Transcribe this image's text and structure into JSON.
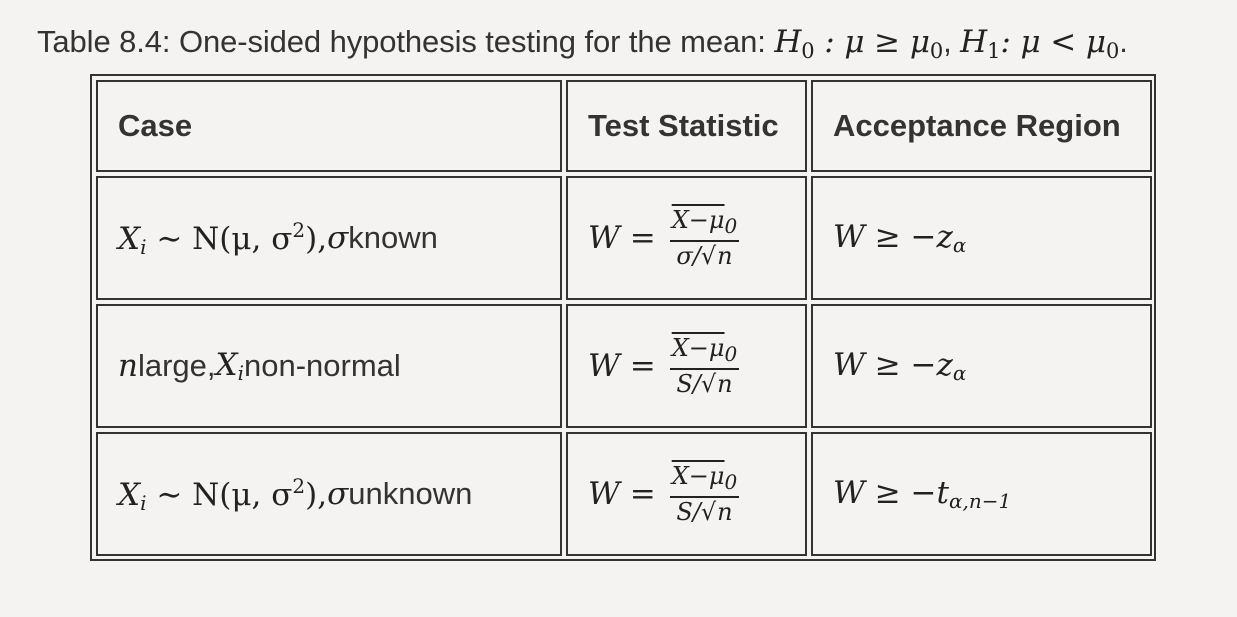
{
  "caption": {
    "prefix": "Table 8.4: One-sided hypothesis testing for the mean: ",
    "h0": "H",
    "h0_sub": "0",
    "h0_rest": " : μ ≥ μ",
    "h0_rest_sub": "0",
    "comma": ", ",
    "h1": "H",
    "h1_sub": "1",
    "h1_rest": ": μ < μ",
    "h1_rest_sub": "0",
    "period": "."
  },
  "table": {
    "headers": [
      "Case",
      "Test Statistic",
      "Acceptance Region"
    ],
    "rows": [
      {
        "case_math": "X",
        "case_math_sub": "i",
        "case_math_rest": " ∼ N(μ, σ",
        "case_math_sup": "2",
        "case_math_close": "),",
        "case_sigma": " σ",
        "case_text": " known",
        "stat_lhs": "W =",
        "stat_num": "X−μ",
        "stat_num_sub": "0",
        "stat_den_pre": "σ/",
        "stat_den_sqrt": "n",
        "region": "W ≥ −z",
        "region_sub": "α"
      },
      {
        "case_n": "n",
        "case_text1": " large, ",
        "case_x": "X",
        "case_x_sub": "i",
        "case_text2": " non-normal",
        "stat_lhs": "W =",
        "stat_num": "X−μ",
        "stat_num_sub": "0",
        "stat_den_pre": "S/",
        "stat_den_sqrt": "n",
        "region": "W ≥ −z",
        "region_sub": "α"
      },
      {
        "case_math": "X",
        "case_math_sub": "i",
        "case_math_rest": " ∼ N(μ, σ",
        "case_math_sup": "2",
        "case_math_close": "),",
        "case_sigma": " σ",
        "case_text": " unknown",
        "stat_lhs": "W =",
        "stat_num": "X−μ",
        "stat_num_sub": "0",
        "stat_den_pre": "S/",
        "stat_den_sqrt": "n",
        "region": "W ≥ −t",
        "region_sub": "α,n−1"
      }
    ]
  }
}
